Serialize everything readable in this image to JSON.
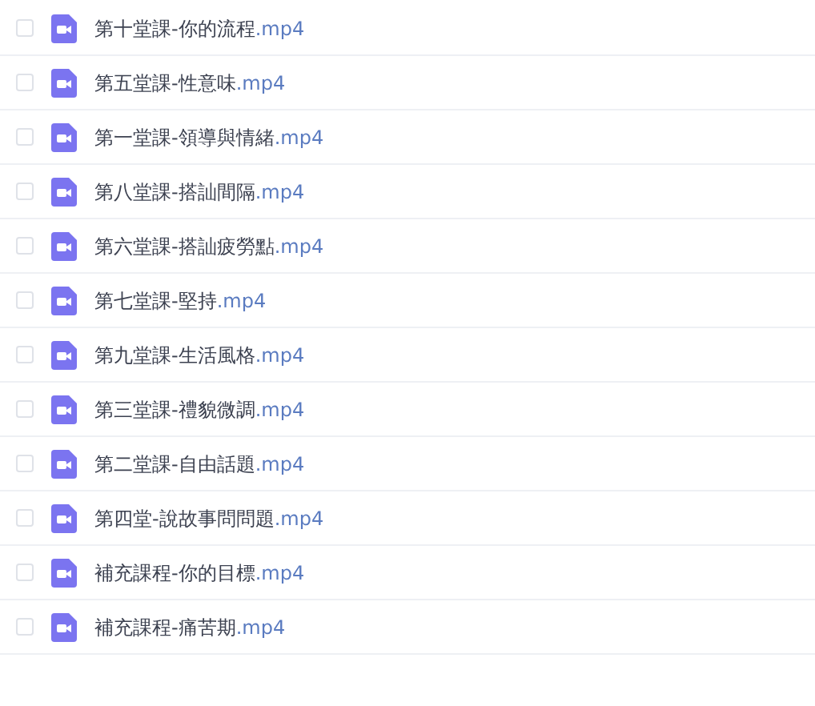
{
  "files": [
    {
      "name": "第十堂課-你的流程",
      "extension": ".mp4",
      "checked": false
    },
    {
      "name": "第五堂課-性意味",
      "extension": ".mp4",
      "checked": false
    },
    {
      "name": "第一堂課-領導與情緒",
      "extension": ".mp4",
      "checked": false
    },
    {
      "name": "第八堂課-搭訕間隔",
      "extension": ".mp4",
      "checked": false
    },
    {
      "name": "第六堂課-搭訕疲勞點",
      "extension": ".mp4",
      "checked": false
    },
    {
      "name": "第七堂課-堅持",
      "extension": ".mp4",
      "checked": false
    },
    {
      "name": "第九堂課-生活風格",
      "extension": ".mp4",
      "checked": false
    },
    {
      "name": "第三堂課-禮貌微調",
      "extension": ".mp4",
      "checked": false
    },
    {
      "name": "第二堂課-自由話題",
      "extension": ".mp4",
      "checked": false
    },
    {
      "name": "第四堂-說故事問問題",
      "extension": ".mp4",
      "checked": false
    },
    {
      "name": "補充課程-你的目標",
      "extension": ".mp4",
      "checked": false
    },
    {
      "name": "補充課程-痛苦期",
      "extension": ".mp4",
      "checked": false
    }
  ]
}
